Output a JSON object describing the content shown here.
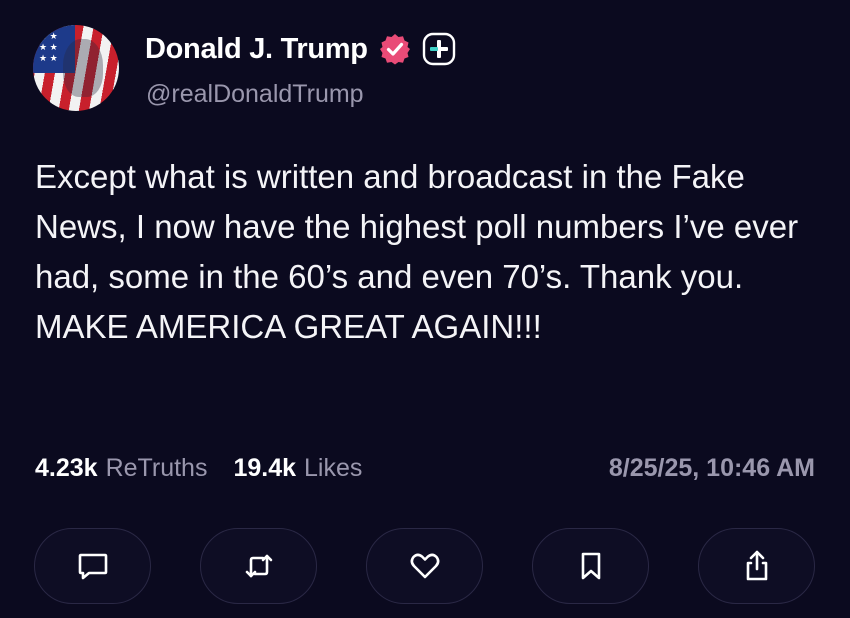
{
  "author": {
    "display_name": "Donald J. Trump",
    "handle": "@realDonaldTrump",
    "verified_icon": "verified-badge-icon",
    "plus_icon": "plus-badge-icon",
    "accent_color": "#e94b77"
  },
  "post": {
    "text": "Except what is written and broadcast in the Fake News, I now have the highest poll numbers I’ve ever had, some in the 60’s and even 70’s. Thank you. MAKE AMERICA GREAT AGAIN!!!"
  },
  "stats": {
    "retruths_count": "4.23k",
    "retruths_label": "ReTruths",
    "likes_count": "19.4k",
    "likes_label": "Likes",
    "timestamp": "8/25/25, 10:46 AM"
  },
  "actions": [
    {
      "icon": "comment-icon"
    },
    {
      "icon": "retruth-icon"
    },
    {
      "icon": "heart-icon"
    },
    {
      "icon": "bookmark-icon"
    },
    {
      "icon": "share-icon"
    }
  ]
}
